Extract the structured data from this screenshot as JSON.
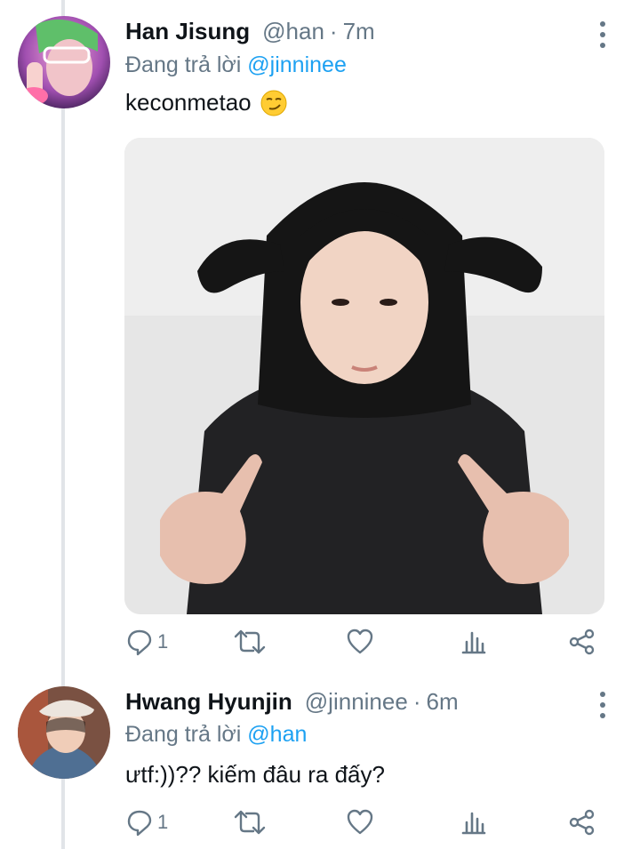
{
  "tweets": [
    {
      "name": "Han Jisung",
      "handle": "@han",
      "time": "7m",
      "replying_prefix": "Đang trả lời ",
      "replying_to": "@jinninee",
      "text": "keconmetao",
      "emoji_icon": "smirk-emoji-icon",
      "reply_count": "1"
    },
    {
      "name": "Hwang Hyunjin",
      "handle": "@jinninee",
      "time": "6m",
      "replying_prefix": "Đang trả lời ",
      "replying_to": "@han",
      "text": "ưtf:))?? kiếm đâu ra đấy?",
      "reply_count": "1"
    }
  ],
  "separator": "·",
  "colors": {
    "link": "#1da1f2",
    "secondary": "#657786",
    "primary_text": "#0f1419"
  }
}
